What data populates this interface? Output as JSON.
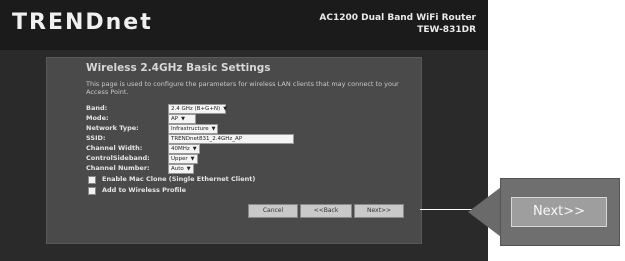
{
  "brand": {
    "logo": "TRENDnet",
    "product_line": "AC1200 Dual Band WiFi Router",
    "model": "TEW-831DR"
  },
  "page": {
    "title": "Wireless 2.4GHz Basic Settings",
    "description": "This page is used to configure the parameters for wireless LAN clients that may connect to your Access Point."
  },
  "settings": [
    {
      "label": "Band:",
      "value": "2.4 GHz (B+G+N)"
    },
    {
      "label": "Mode:",
      "value": "AP"
    },
    {
      "label": "Network Type:",
      "value": "Infrastructure"
    },
    {
      "label": "SSID:",
      "value": "TRENDnet831_2.4GHz_AP"
    },
    {
      "label": "Channel Width:",
      "value": "40MHz"
    },
    {
      "label": "ControlSideband:",
      "value": "Upper"
    },
    {
      "label": "Channel Number:",
      "value": "Auto"
    }
  ],
  "checks": [
    {
      "label": "Enable Mac Clone (Single Ethernet Client)"
    },
    {
      "label": "Add to Wireless Profile"
    }
  ],
  "buttons": {
    "cancel": "Cancel",
    "back": "<<Back",
    "next": "Next>>"
  },
  "callout": {
    "label": "Next>>"
  }
}
